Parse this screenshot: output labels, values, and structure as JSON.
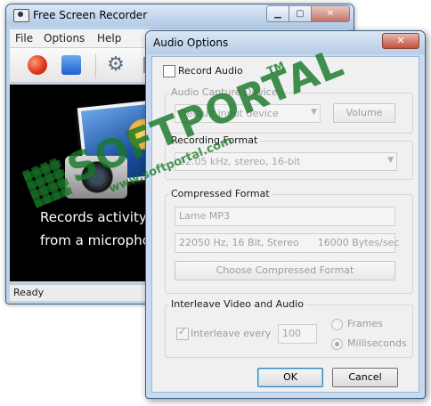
{
  "main_window": {
    "title": "Free Screen Recorder",
    "menu": [
      "File",
      "Options",
      "Help"
    ],
    "toolbar": [
      "record-icon",
      "stop-icon",
      "gear-icon"
    ],
    "content_lines": [
      "Records activity",
      "from a micropho"
    ],
    "status": "Ready"
  },
  "dialog": {
    "title": "Audio Options",
    "close_label": "✕",
    "record_audio_label": "Record Audio",
    "capture_device_label": "Audio Capture Device",
    "capture_device_value": "Default input device",
    "volume_label": "Volume",
    "recording_format_label": "Recording Format",
    "recording_format_value": "22.05 kHz, stereo, 16-bit",
    "compressed_format_label": "Compressed Format",
    "codec_value": "Lame MP3",
    "codec_details_value": "22050 Hz, 16 Bit, Stereo      16000 Bytes/sec",
    "choose_compressed_label": "Choose  Compressed Format",
    "interleave_group_label": "Interleave Video and Audio",
    "interleave_every_label": "Interleave every",
    "interleave_value": "100",
    "frames_label": "Frames",
    "milliseconds_label": "Milliseconds",
    "ok_label": "OK",
    "cancel_label": "Cancel"
  },
  "watermark": {
    "logo": "SOFTPORTAL",
    "tm": "TM",
    "url": "www.softportal.com"
  },
  "colors": {
    "accent": "#3c7fb1",
    "record": "#e0391b",
    "stop": "#1f5fcf",
    "watermark": "#197828"
  }
}
